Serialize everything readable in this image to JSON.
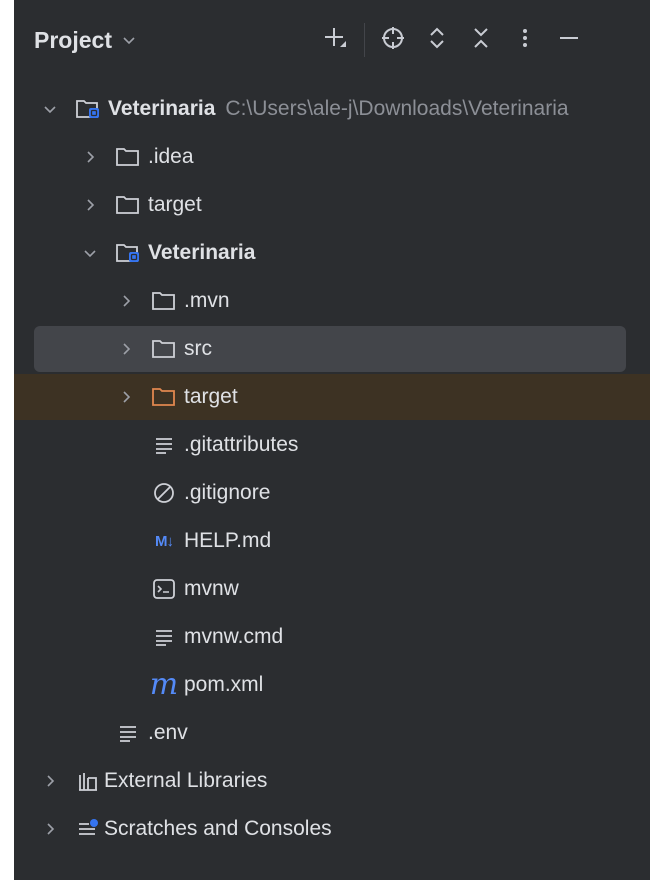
{
  "header": {
    "title": "Project",
    "tools": [
      "add-icon",
      "locate-icon",
      "expand-all-icon",
      "collapse-all-icon",
      "more-options-icon",
      "minimize-icon"
    ]
  },
  "tree": {
    "root": {
      "label": "Veterinaria",
      "path": "C:\\Users\\ale-j\\Downloads\\Veterinaria"
    },
    "idea": {
      "label": ".idea"
    },
    "target_top": {
      "label": "target"
    },
    "module": {
      "label": "Veterinaria"
    },
    "mvn": {
      "label": ".mvn"
    },
    "src": {
      "label": "src"
    },
    "target_module": {
      "label": "target"
    },
    "gitattributes": {
      "label": ".gitattributes"
    },
    "gitignore": {
      "label": ".gitignore"
    },
    "help_md": {
      "label": "HELP.md",
      "icon_text": "M↓"
    },
    "mvnw": {
      "label": "mvnw"
    },
    "mvnw_cmd": {
      "label": "mvnw.cmd"
    },
    "pom_xml": {
      "label": "pom.xml",
      "icon_text": "m"
    },
    "env": {
      "label": ".env"
    },
    "external_libraries": {
      "label": "External Libraries"
    },
    "scratches": {
      "label": "Scratches and Consoles"
    }
  },
  "colors": {
    "panel_bg": "#2b2d30",
    "text": "#dfe1e5",
    "muted_text": "#8c8f96",
    "selection": "#43454a",
    "excluded_highlight": "#3d3223",
    "excluded_folder": "#e0874f",
    "module_accent": "#3574f0",
    "maven_blue": "#548af7"
  }
}
